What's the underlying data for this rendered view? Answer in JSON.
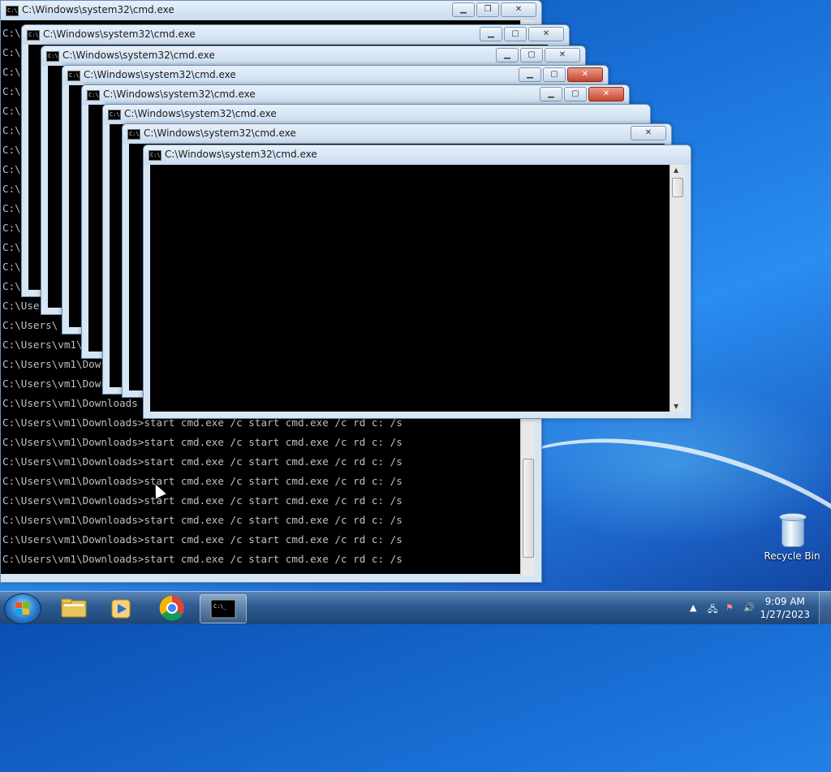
{
  "window_title": "C:\\Windows\\system32\\cmd.exe",
  "console": {
    "prompt_lines": [
      "C:\\",
      "C:\\",
      "C:\\",
      "C:\\",
      "C:\\",
      "C:\\",
      "C:\\",
      "C:\\",
      "C:\\",
      "C:\\",
      "C:\\",
      "C:\\",
      "C:\\",
      "C:\\",
      "C:\\Use",
      "C:\\Users\\",
      "C:\\Users\\vm1\\",
      "C:\\Users\\vm1\\Dow",
      "C:\\Users\\vm1\\Downlo",
      "C:\\Users\\vm1\\Downloads",
      "C:\\Users\\vm1\\Downloads>start cmd.exe /c start cmd.exe /c rd c: /s",
      "C:\\Users\\vm1\\Downloads>start cmd.exe /c start cmd.exe /c rd c: /s",
      "C:\\Users\\vm1\\Downloads>start cmd.exe /c start cmd.exe /c rd c: /s",
      "C:\\Users\\vm1\\Downloads>start cmd.exe /c start cmd.exe /c rd c: /s",
      "C:\\Users\\vm1\\Downloads>start cmd.exe /c start cmd.exe /c rd c: /s",
      "C:\\Users\\vm1\\Downloads>start cmd.exe /c start cmd.exe /c rd c: /s",
      "C:\\Users\\vm1\\Downloads>start cmd.exe /c start cmd.exe /c rd c: /s",
      "C:\\Users\\vm1\\Downloads>start cmd.exe /c start cmd.exe /c rd c: /s"
    ]
  },
  "desktop": {
    "recycle_bin_label": "Recycle Bin"
  },
  "taskbar": {
    "time": "9:09 AM",
    "date": "1/27/2023",
    "pinned": [
      "windows-explorer",
      "windows-media-player",
      "google-chrome",
      "command-prompt"
    ]
  },
  "colors": {
    "console_bg": "#000000",
    "console_fg": "#c0c0c0",
    "close_red": "#c8462f"
  }
}
